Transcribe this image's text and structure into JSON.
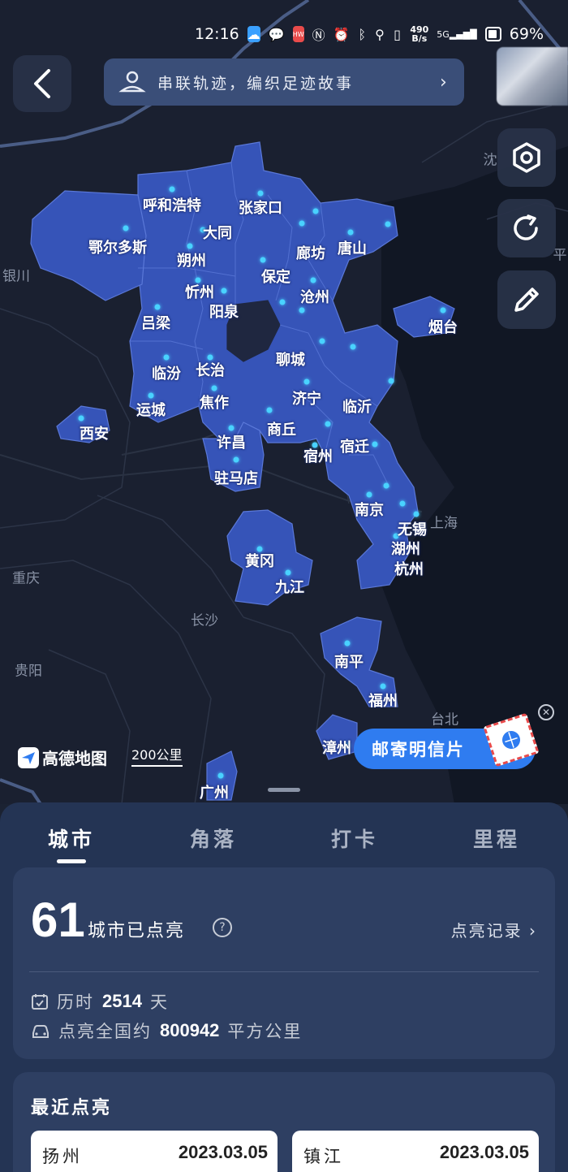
{
  "status_bar": {
    "time": "12:16",
    "network_speed_value": "490",
    "network_speed_unit": "B/s",
    "network_type": "5G",
    "battery": "69%"
  },
  "header": {
    "banner_text": "串联轨迹，编织足迹故事"
  },
  "map": {
    "visited_cities": [
      "呼和浩特",
      "张家口",
      "大同",
      "鄂尔多斯",
      "朔州",
      "廊坊",
      "唐山",
      "保定",
      "忻州",
      "阳泉",
      "沧州",
      "吕梁",
      "烟台",
      "聊城",
      "临汾",
      "长治",
      "济宁",
      "临沂",
      "运城",
      "焦作",
      "西安",
      "商丘",
      "许昌",
      "宿迁",
      "宿州",
      "驻马店",
      "南京",
      "无锡",
      "湖州",
      "杭州",
      "黄冈",
      "九江",
      "南平",
      "福州",
      "漳州",
      "广州"
    ],
    "reference_labels": [
      "沈",
      "平",
      "银川",
      "上海",
      "重庆",
      "长沙",
      "贵阳",
      "台北"
    ],
    "attribution": "高德地图",
    "scale": "200公里"
  },
  "postcard": {
    "label": "邮寄明信片"
  },
  "tabs": [
    "城市",
    "角落",
    "打卡",
    "里程"
  ],
  "active_tab": "城市",
  "stats": {
    "count": "61",
    "count_label": "城市已点亮",
    "records_link": "点亮记录",
    "duration_prefix": "历时",
    "duration_value": "2514",
    "duration_unit": "天",
    "area_prefix": "点亮全国约",
    "area_value": "800942",
    "area_unit": "平方公里"
  },
  "recent": {
    "title": "最近点亮",
    "items": [
      {
        "city": "扬州",
        "date": "2023.03.05"
      },
      {
        "city": "镇江",
        "date": "2023.03.05"
      }
    ]
  },
  "colors": {
    "map_bg": "#1a2030",
    "visited_region": "#3654b8",
    "dot": "#49d2ff",
    "sheet": "#243454",
    "card": "#2e3f62",
    "accent_button": "#2f7cf0"
  }
}
